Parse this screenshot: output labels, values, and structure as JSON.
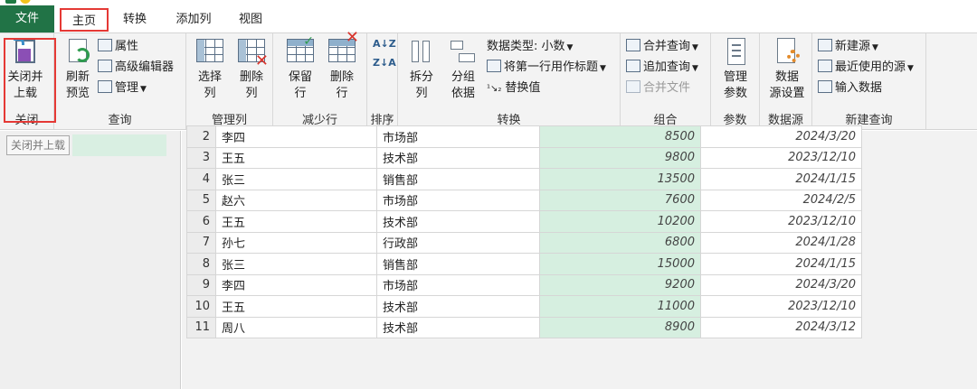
{
  "menu": {
    "file": "文件",
    "tabs": [
      "主页",
      "转换",
      "添加列",
      "视图"
    ]
  },
  "ribbon": {
    "close": {
      "button": "关闭并\n上载",
      "group": "关闭"
    },
    "query": {
      "refresh": "刷新\n预览",
      "properties": "属性",
      "advanced_editor": "高级编辑器",
      "manage": "管理",
      "group": "查询"
    },
    "manage_columns": {
      "choose": "选择\n列",
      "remove": "删除\n列",
      "group": "管理列"
    },
    "reduce_rows": {
      "keep": "保留\n行",
      "remove": "删除\n行",
      "group": "减少行"
    },
    "sort": {
      "group": "排序",
      "asc": "A↓Z",
      "desc": "Z↓A"
    },
    "transform": {
      "split": "拆分\n列",
      "groupby": "分组\n依据",
      "datatype": "数据类型: 小数",
      "first_row_header": "将第一行用作标题",
      "replace": "替换值",
      "group": "转换"
    },
    "combine": {
      "merge_queries": "合并查询",
      "append_queries": "追加查询",
      "merge_files": "合并文件",
      "group": "组合"
    },
    "parameters": {
      "manage": "管理\n参数",
      "group": "参数"
    },
    "datasource": {
      "settings": "数据\n源设置",
      "group": "数据源"
    },
    "new_query": {
      "new_source": "新建源",
      "recent_sources": "最近使用的源",
      "enter_data": "输入数据",
      "group": "新建查询"
    }
  },
  "left_panel": {
    "tooltip": "关闭并上载"
  },
  "accent_color": "#217346",
  "highlight_color": "#e53935",
  "table": {
    "partial_row": {
      "num": "2",
      "name": "李四",
      "dept": "市场部",
      "amount": "8500",
      "date": "2024/3/20"
    },
    "rows": [
      {
        "num": "3",
        "name": "王五",
        "dept": "技术部",
        "amount": "9800",
        "date": "2023/12/10"
      },
      {
        "num": "4",
        "name": "张三",
        "dept": "销售部",
        "amount": "13500",
        "date": "2024/1/15"
      },
      {
        "num": "5",
        "name": "赵六",
        "dept": "市场部",
        "amount": "7600",
        "date": "2024/2/5"
      },
      {
        "num": "6",
        "name": "王五",
        "dept": "技术部",
        "amount": "10200",
        "date": "2023/12/10"
      },
      {
        "num": "7",
        "name": "孙七",
        "dept": "行政部",
        "amount": "6800",
        "date": "2024/1/28"
      },
      {
        "num": "8",
        "name": "张三",
        "dept": "销售部",
        "amount": "15000",
        "date": "2024/1/15"
      },
      {
        "num": "9",
        "name": "李四",
        "dept": "市场部",
        "amount": "9200",
        "date": "2024/3/20"
      },
      {
        "num": "10",
        "name": "王五",
        "dept": "技术部",
        "amount": "11000",
        "date": "2023/12/10"
      },
      {
        "num": "11",
        "name": "周八",
        "dept": "技术部",
        "amount": "8900",
        "date": "2024/3/12"
      }
    ]
  }
}
